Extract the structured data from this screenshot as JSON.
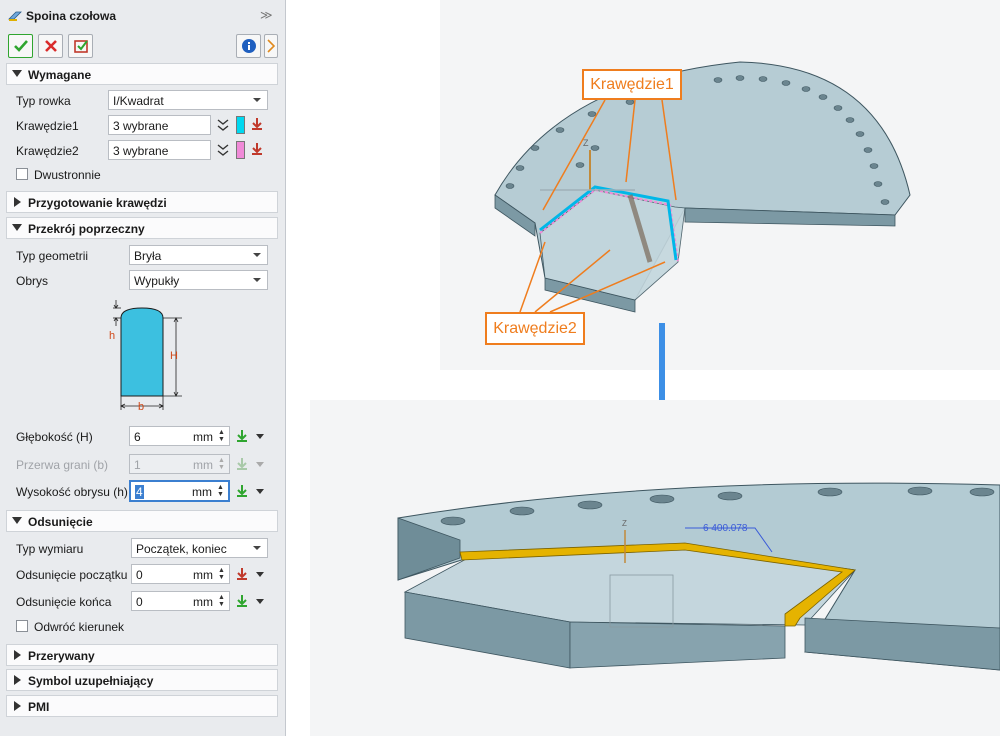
{
  "dialog": {
    "title": "Spoina czołowa",
    "toolbar": {
      "ok_icon": "check-icon",
      "cancel_icon": "close-icon",
      "apply_icon": "apply-icon",
      "info_icon": "info-icon",
      "colors": {
        "ok": "#2fa52f",
        "cancel": "#d92b2b",
        "info": "#1f5fbf"
      }
    },
    "sections": {
      "required": {
        "label": "Wymagane",
        "groove_type": {
          "label": "Typ rowka",
          "value": "I/Kwadrat"
        },
        "edges1": {
          "label": "Krawędzie1",
          "value": "3 wybrane",
          "color": "#00d8f0"
        },
        "edges2": {
          "label": "Krawędzie2",
          "value": "3 wybrane",
          "color": "#f08ad8"
        },
        "double_sided": {
          "label": "Dwustronnie",
          "checked": false
        }
      },
      "edge_prep": {
        "label": "Przygotowanie krawędzi"
      },
      "cross_section": {
        "label": "Przekrój poprzeczny",
        "geometry_type": {
          "label": "Typ geometrii",
          "value": "Bryła"
        },
        "profile": {
          "label": "Obrys",
          "value": "Wypukły"
        },
        "diagram": {
          "h": "h",
          "H": "H",
          "b": "b",
          "fill": "#3cc0e0"
        },
        "depth": {
          "label": "Głębokość (H)",
          "value": "6",
          "unit": "mm"
        },
        "face_gap": {
          "label": "Przerwa grani (b)",
          "value": "1",
          "unit": "mm",
          "disabled": true
        },
        "profile_height": {
          "label": "Wysokość obrysu (h)",
          "value": "4",
          "unit": "mm"
        }
      },
      "offset": {
        "label": "Odsunięcie",
        "dimension_type": {
          "label": "Typ wymiaru",
          "value": "Początek, koniec"
        },
        "start_offset": {
          "label": "Odsunięcie początku",
          "value": "0",
          "unit": "mm"
        },
        "end_offset": {
          "label": "Odsunięcie końca",
          "value": "0",
          "unit": "mm"
        },
        "reverse": {
          "label": "Odwróć kierunek",
          "checked": false
        }
      },
      "intermittent": {
        "label": "Przerywany"
      },
      "supplementary": {
        "label": "Symbol uzupełniający"
      },
      "pmi": {
        "label": "PMI"
      }
    }
  },
  "viewport": {
    "callout_edges1": "Krawędzie1",
    "callout_edges2": "Krawędzie2",
    "weld_annotation": "6 400.078",
    "axis_label": "Z",
    "arrow_color": "#3c8fe6",
    "callout_color": "#ef7d1e",
    "weld_color": "#e5b300",
    "plate_color": "#a7c2cc"
  }
}
